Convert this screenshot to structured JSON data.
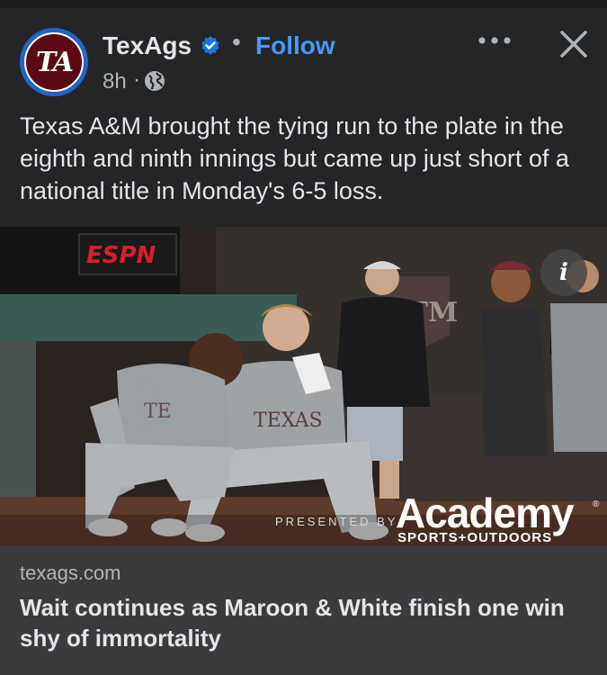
{
  "post": {
    "page_name": "TexAgs",
    "avatar_text": "TA",
    "follow_label": "Follow",
    "separator": "•",
    "time": "8h",
    "time_separator": "·",
    "audience_icon": "globe-icon",
    "more_icon": "more-horizontal-icon",
    "close_icon": "close-icon",
    "text": "Texas A&M brought the tying run to the plate in the eighth and ninth innings but came up just short of a national title in Monday's 6-5 loss."
  },
  "photo": {
    "info_label": "i",
    "scoreboard_logo": "ESPN",
    "wall_logo": "ATM",
    "jersey_text": "TEXAS",
    "sponsor_presented": "PRESENTED BY",
    "sponsor_name": "Academy",
    "sponsor_sub": "SPORTS+OUTDOORS",
    "sponsor_reg": "®"
  },
  "link": {
    "domain": "texags.com",
    "title": "Wait continues as Maroon & White finish one win shy of immortality"
  },
  "colors": {
    "background": "#242526",
    "card": "#3a3b3c",
    "accent": "#4599ff",
    "brand_maroon": "#5b0a14",
    "verified": "#1b74e4"
  }
}
